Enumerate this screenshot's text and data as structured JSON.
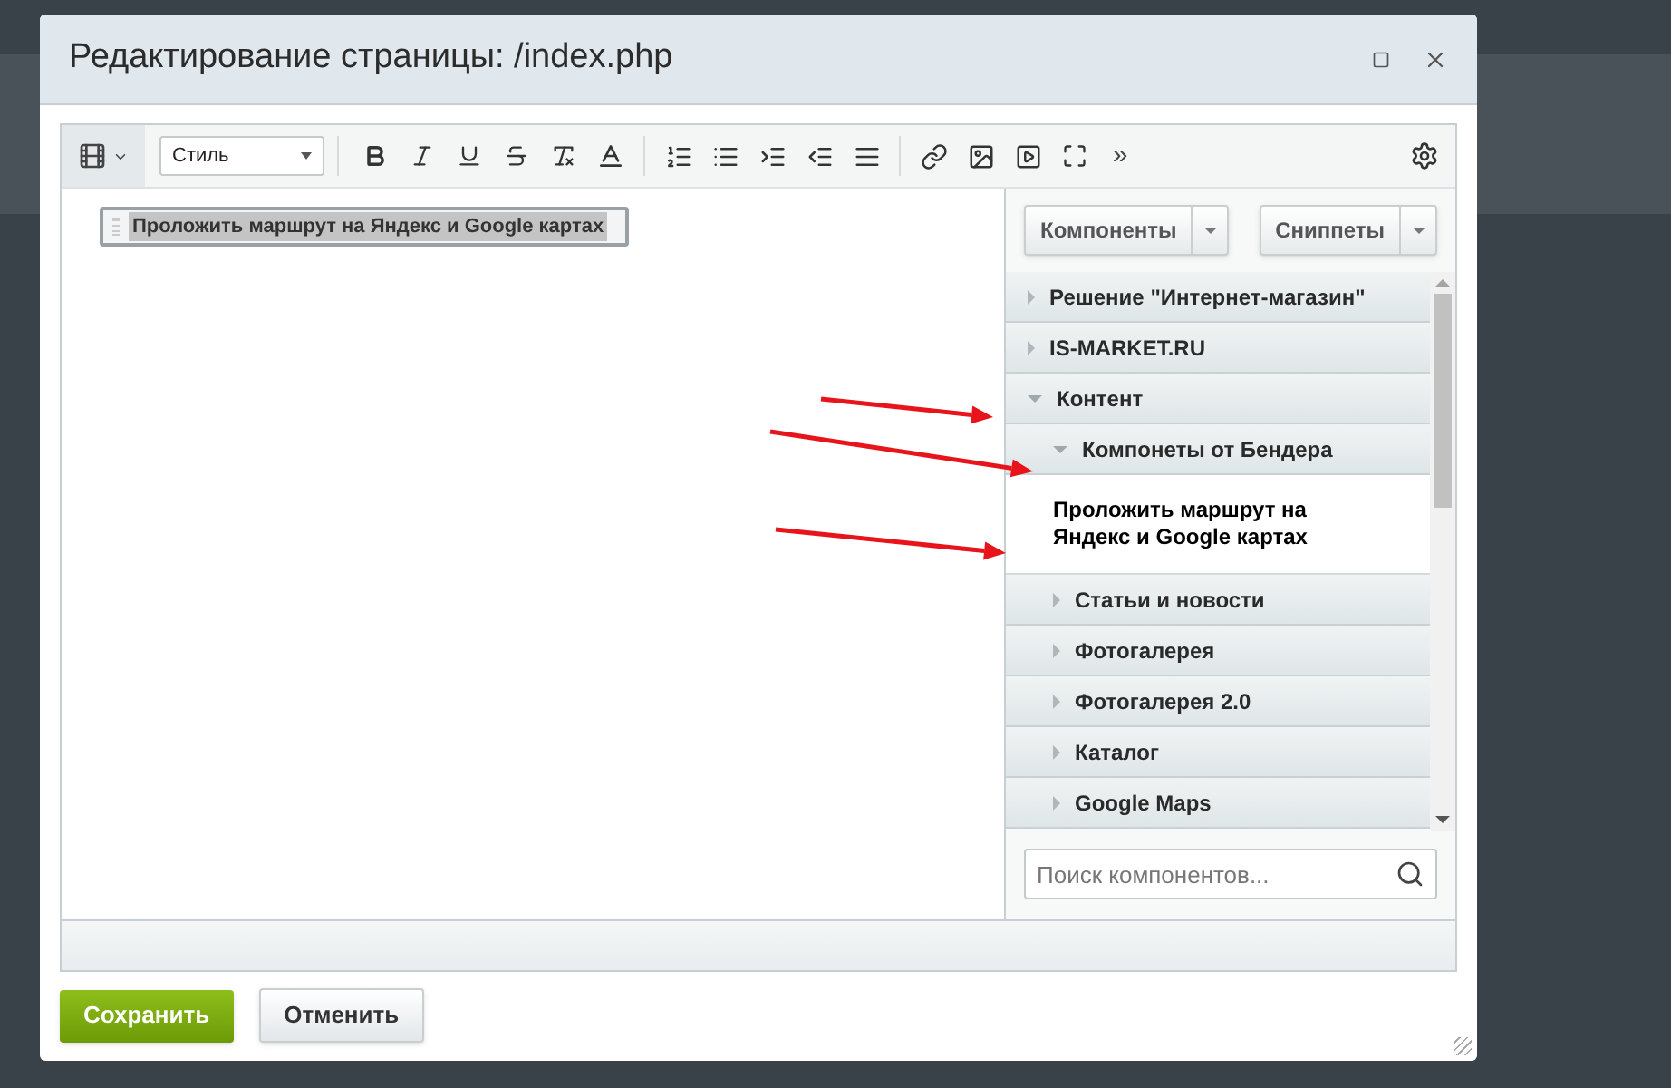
{
  "dialog": {
    "title": "Редактирование страницы: /index.php"
  },
  "toolbar": {
    "style_select": "Стиль",
    "more": "»"
  },
  "editor": {
    "component_block": "Проложить маршрут на Яндекс и Google картах"
  },
  "panel": {
    "buttons": [
      "Компоненты",
      "Сниппеты"
    ],
    "tree": [
      {
        "label": "Решение \"Интернет-магазин\"",
        "kind": "folder",
        "expanded": false
      },
      {
        "label": "IS-MARKET.RU",
        "kind": "folder",
        "expanded": false
      },
      {
        "label": "Контент",
        "kind": "folder",
        "expanded": true,
        "children": [
          {
            "label": "Компонеты от Бендера",
            "kind": "folder",
            "expanded": true,
            "children": [
              {
                "label": "Проложить маршрут на Яндекс и Google картах",
                "kind": "component"
              }
            ]
          },
          {
            "label": "Статьи и новости",
            "kind": "folder",
            "expanded": false
          },
          {
            "label": "Фотогалерея",
            "kind": "folder",
            "expanded": false
          },
          {
            "label": "Фотогалерея 2.0",
            "kind": "folder",
            "expanded": false
          },
          {
            "label": "Каталог",
            "kind": "folder",
            "expanded": false
          },
          {
            "label": "Google Maps",
            "kind": "folder",
            "expanded": false
          }
        ]
      }
    ],
    "search": {
      "placeholder": "Поиск компонентов..."
    }
  },
  "footer": {
    "save": "Сохранить",
    "cancel": "Отменить"
  }
}
